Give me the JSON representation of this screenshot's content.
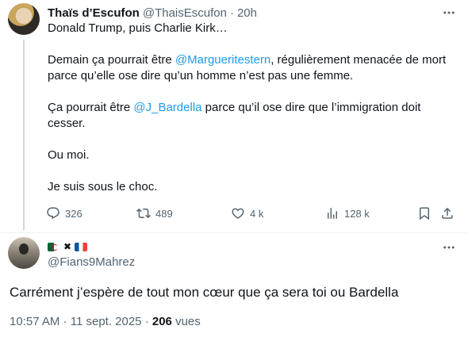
{
  "tweet": {
    "author_name": "Thaïs d’Escufon",
    "author_handle": "@ThaisEscufon",
    "separator": "·",
    "time": "20h",
    "line1": "Donald Trump, puis Charlie Kirk…",
    "line2_pre": "Demain ça pourrait être ",
    "line2_mention": "@Margueritestern",
    "line2_post": ", régulièrement menacée de mort parce qu’elle ose dire qu’un homme n’est pas une femme.",
    "line3_pre": "Ça pourrait être ",
    "line3_mention": "@J_Bardella",
    "line3_post": " parce qu’il ose dire que l’immigration doit cesser.",
    "line4": "Ou moi.",
    "line5": "Je suis sous le choc.",
    "actions": {
      "replies": "326",
      "reposts": "489",
      "likes": "4 k",
      "views": "128 k"
    }
  },
  "reply": {
    "display_name_emojis": "🇩🇿 ✖ 🇫🇷",
    "handle": "@Fians9Mahrez",
    "text": "Carrément j’espère de tout mon cœur que ça sera toi ou Bardella",
    "time": "10:57 AM",
    "separator": "·",
    "date": "11 sept. 2025",
    "separator2": "·",
    "views_count": "206",
    "views_label": " vues"
  },
  "icons": {
    "more": "more-horizontal-icon",
    "reply": "reply-icon",
    "repost": "repost-icon",
    "like": "heart-icon",
    "views": "views-chart-icon",
    "bookmark": "bookmark-icon",
    "share": "share-icon"
  },
  "colors": {
    "text": "#0f1419",
    "secondary": "#536471",
    "link": "#1d9bf0",
    "divider": "#eff3f4"
  }
}
